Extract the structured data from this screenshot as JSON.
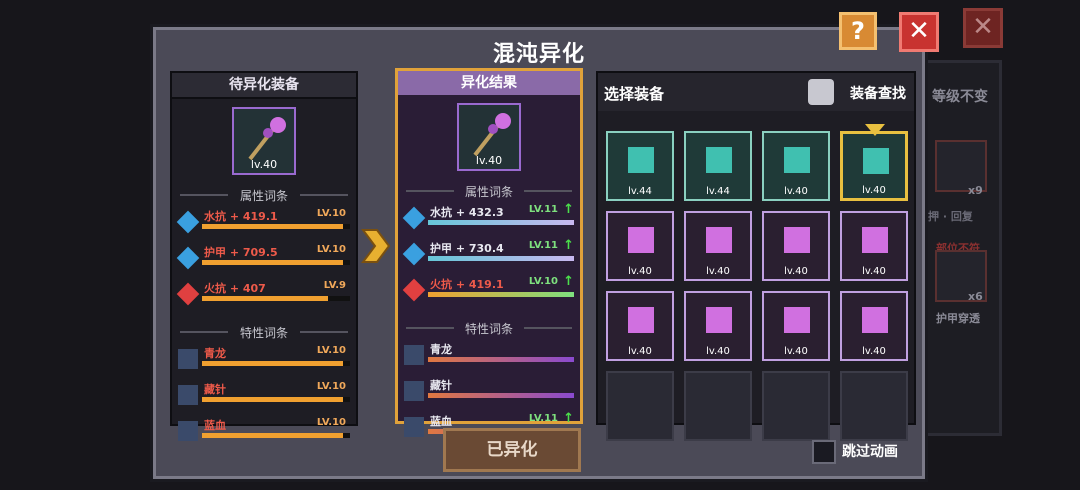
{
  "background": {
    "text_right": "等级不变",
    "count1": "x9",
    "count2": "x6",
    "label1": "护甲穿透",
    "label2": "押 · 回复",
    "label3": "部位不符"
  },
  "dialog": {
    "title": "混沌异化",
    "help_label": "?",
    "close_label": "✕"
  },
  "left_panel": {
    "header": "待异化装备",
    "item_level": "lv.40",
    "attr_section": "属性词条",
    "trait_section": "特性词条",
    "stats": [
      {
        "label": "水抗 + 419.1",
        "level": "LV.10",
        "fill": 0.95,
        "gem": "blue"
      },
      {
        "label": "护甲 + 709.5",
        "level": "LV.10",
        "fill": 0.95,
        "gem": "blue"
      },
      {
        "label": "火抗 + 407",
        "level": "LV.9",
        "fill": 0.85,
        "gem": "red"
      }
    ],
    "traits": [
      {
        "label": "青龙",
        "level": "LV.10",
        "fill": 0.95
      },
      {
        "label": "藏针",
        "level": "LV.10",
        "fill": 0.95
      },
      {
        "label": "蓝血",
        "level": "LV.10",
        "fill": 0.95
      }
    ]
  },
  "mid_panel": {
    "header": "异化结果",
    "item_level": "lv.40",
    "attr_section": "属性词条",
    "trait_section": "特性词条",
    "stats": [
      {
        "label": "水抗 + 432.3",
        "level": "LV.11",
        "arrow": "↑",
        "fill": 1.0,
        "gem": "blue"
      },
      {
        "label": "护甲 + 730.4",
        "level": "LV.11",
        "arrow": "↑",
        "fill": 1.0,
        "gem": "blue"
      },
      {
        "label": "火抗 + 419.1",
        "level": "LV.10",
        "arrow": "↑",
        "fill": 1.0,
        "gem": "red"
      }
    ],
    "traits": [
      {
        "label": "青龙",
        "level": "",
        "arrow": "",
        "fill": 1.0
      },
      {
        "label": "藏针",
        "level": "",
        "arrow": "",
        "fill": 1.0
      },
      {
        "label": "蓝血",
        "level": "LV.11",
        "arrow": "↑",
        "fill": 1.0
      }
    ]
  },
  "right_panel": {
    "header": "选择装备",
    "search_label": "装备查找",
    "items": [
      {
        "level": "lv.44",
        "style": "teal"
      },
      {
        "level": "lv.44",
        "style": "teal"
      },
      {
        "level": "lv.40",
        "style": "teal"
      },
      {
        "level": "lv.40",
        "style": "teal",
        "selected": true
      },
      {
        "level": "lv.40",
        "style": "pink"
      },
      {
        "level": "lv.40",
        "style": "pink"
      },
      {
        "level": "lv.40",
        "style": "pink"
      },
      {
        "level": "lv.40",
        "style": "pink"
      },
      {
        "level": "lv.40",
        "style": "pink"
      },
      {
        "level": "lv.40",
        "style": "pink"
      },
      {
        "level": "lv.40",
        "style": "pink"
      },
      {
        "level": "lv.40",
        "style": "pink"
      },
      {
        "level": "",
        "style": "empty"
      },
      {
        "level": "",
        "style": "empty"
      },
      {
        "level": "",
        "style": "empty"
      },
      {
        "level": "",
        "style": "empty"
      }
    ]
  },
  "footer": {
    "done_label": "已异化",
    "skip_label": "跳过动画"
  }
}
